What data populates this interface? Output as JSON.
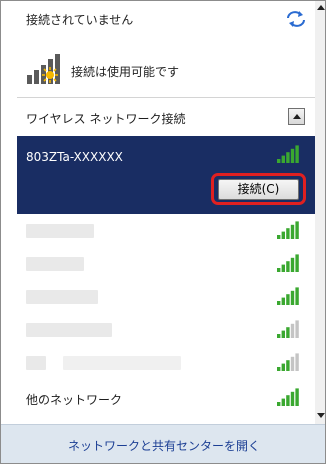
{
  "header": {
    "status_text": "接続されていません",
    "availability_text": "接続は使用可能です",
    "icons": [
      "refresh-icon",
      "network-available-icon"
    ]
  },
  "section": {
    "title": "ワイヤレス ネットワーク接続"
  },
  "selected_network": {
    "name": "803ZTa-XXXXXX",
    "connect_label": "接続(C)",
    "signal_level": 1.0
  },
  "networks": [
    {
      "signal_level": 1.0
    },
    {
      "signal_level": 1.0
    },
    {
      "signal_level": 1.0
    },
    {
      "signal_level": 0.6
    },
    {
      "signal_level": 0.6
    }
  ],
  "other_network": {
    "label": "他のネットワーク",
    "signal_level": 1.0
  },
  "footer": {
    "link_label": "ネットワークと共有センターを開く"
  },
  "colors": {
    "selected_background": "#192d63",
    "highlight_border": "#e02020",
    "signal_active": "#3aa830",
    "signal_inactive": "#c4c4c4",
    "link": "#1c3f94"
  }
}
